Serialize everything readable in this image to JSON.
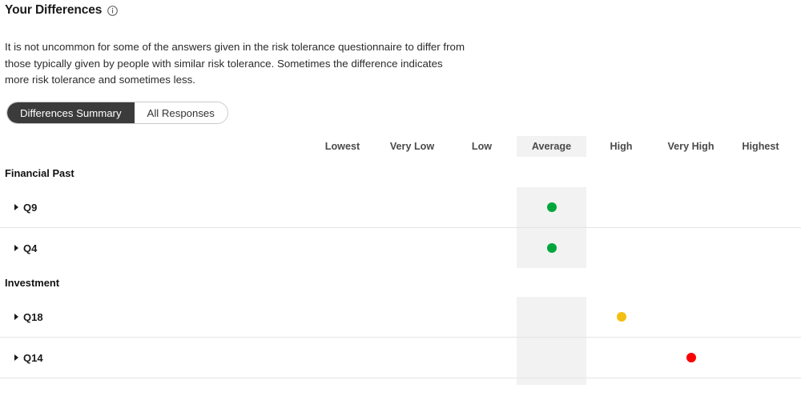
{
  "header": {
    "title": "Your Differences",
    "info_icon": "info-circle-icon",
    "description": "It is not uncommon for some of the answers given in the risk tolerance questionnaire to differ from those typically given by people with similar risk tolerance. Sometimes the difference indicates more risk tolerance and sometimes less."
  },
  "tabs": [
    {
      "label": "Differences Summary",
      "active": true
    },
    {
      "label": "All Responses",
      "active": false
    }
  ],
  "matrix": {
    "columns": [
      {
        "label": "Lowest",
        "highlight": false
      },
      {
        "label": "Very Low",
        "highlight": false
      },
      {
        "label": "Low",
        "highlight": false
      },
      {
        "label": "Average",
        "highlight": true
      },
      {
        "label": "High",
        "highlight": false
      },
      {
        "label": "Very High",
        "highlight": false
      },
      {
        "label": "Highest",
        "highlight": false
      }
    ],
    "sections": [
      {
        "title": "Financial Past",
        "rows": [
          {
            "label": "Q9",
            "column": "Average",
            "dot_color": "#00a63c"
          },
          {
            "label": "Q4",
            "column": "Average",
            "dot_color": "#00a63c"
          }
        ]
      },
      {
        "title": "Investment",
        "rows": [
          {
            "label": "Q18",
            "column": "High",
            "dot_color": "#f2c013"
          },
          {
            "label": "Q14",
            "column": "Very High",
            "dot_color": "#fa0000"
          }
        ]
      }
    ],
    "colors": {
      "highlight_band": "#f2f2f2",
      "divider": "#e4e4e4",
      "green": "#00a63c",
      "yellow": "#f2c013",
      "red": "#fa0000"
    }
  }
}
